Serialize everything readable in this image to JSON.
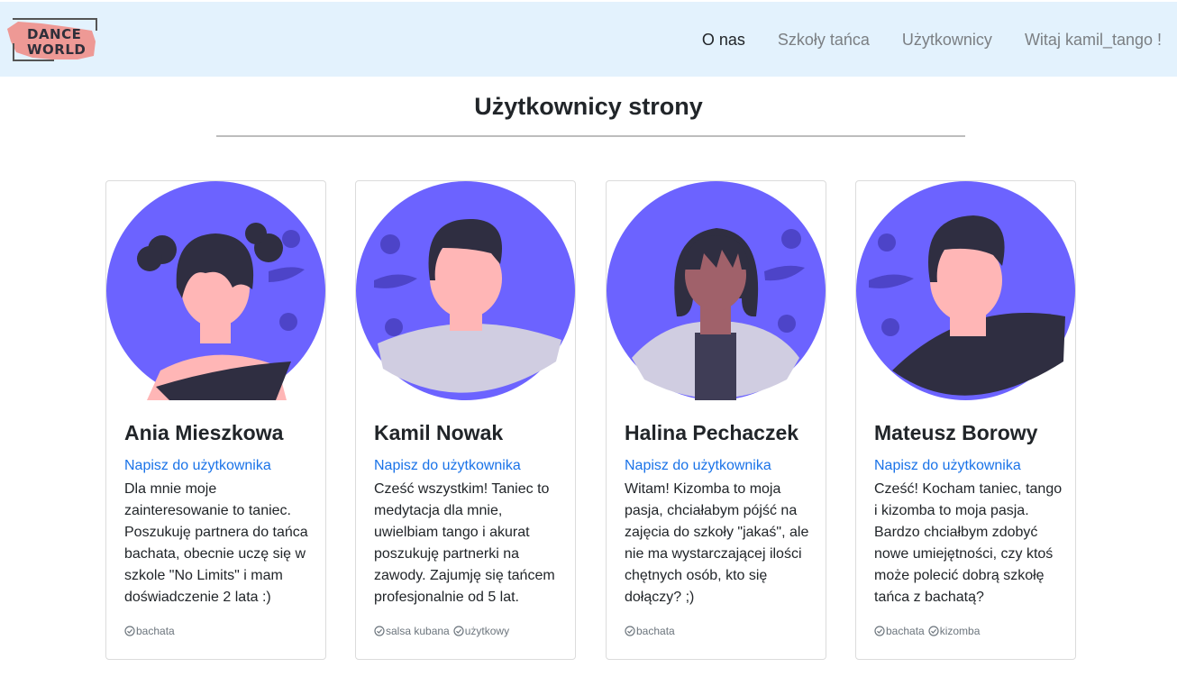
{
  "header": {
    "logo_line1": "DANCE",
    "logo_line2": "WORLD",
    "nav": [
      {
        "label": "O nas"
      },
      {
        "label": "Szkoły tańca"
      },
      {
        "label": "Użytkownicy"
      },
      {
        "label": "Witaj kamil_tango !"
      }
    ]
  },
  "page": {
    "title": "Użytkownicy strony"
  },
  "users": [
    {
      "name": "Ania Mieszkowa",
      "message_link": "Napisz do użytkownika",
      "bio": "Dla mnie moje zainteresowanie to taniec. Poszukuję partnera do tańca bachata, obecnie uczę się w szkole \"No Limits\" i mam doświadczenie 2 lata :)",
      "tags": [
        "bachata"
      ]
    },
    {
      "name": "Kamil Nowak",
      "message_link": "Napisz do użytkownika",
      "bio": "Cześć wszystkim! Taniec to medytacja dla mnie, uwielbiam tango i akurat poszukuję partnerki na zawody. Zajumję się tańcem profesjonalnie od 5 lat.",
      "tags": [
        "salsa kubana",
        "użytkowy"
      ]
    },
    {
      "name": "Halina Pechaczek",
      "message_link": "Napisz do użytkownika",
      "bio": "Witam! Kizomba to moja pasja, chciałabym pójść na zajęcia do szkoły \"jakaś\", ale nie ma wystarczającej ilości chętnych osób, kto się dołączy? ;)",
      "tags": [
        "bachata"
      ]
    },
    {
      "name": "Mateusz Borowy",
      "message_link": "Napisz do użytkownika",
      "bio": "Cześć! Kocham taniec, tango i kizomba to moja pasja. Bardzo chciałbym zdobyć nowe umiejętności, czy ktoś może polecić dobrą szkołę tańca z bachatą?",
      "tags": [
        "bachata",
        "kizomba"
      ]
    }
  ],
  "colors": {
    "navbar_bg": "#e3f2fd",
    "avatar_bg": "#6c63ff",
    "link": "#1a73e8",
    "logo_brush": "#f08a82"
  }
}
